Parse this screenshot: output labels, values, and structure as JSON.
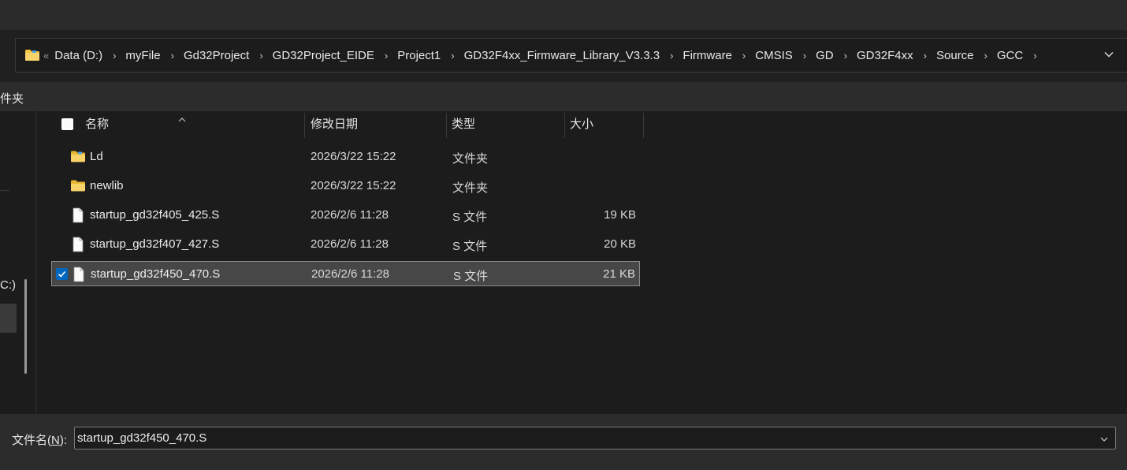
{
  "address": {
    "overflow": "«",
    "crumbs": [
      "Data (D:)",
      "myFile",
      "Gd32Project",
      "GD32Project_EIDE",
      "Project1",
      "GD32F4xx_Firmware_Library_V3.3.3",
      "Firmware",
      "CMSIS",
      "GD",
      "GD32F4xx",
      "Source",
      "GCC"
    ],
    "separator": "›"
  },
  "toolbar": {
    "partial_text": "件夹"
  },
  "nav": {
    "drive_label": "C:)"
  },
  "columns": {
    "name": "名称",
    "date": "修改日期",
    "type": "类型",
    "size": "大小"
  },
  "files": [
    {
      "name": "Ld",
      "date": "2026/3/22 15:22",
      "type": "文件夹",
      "size": "",
      "icon": "folder-icon",
      "selected": false
    },
    {
      "name": "newlib",
      "date": "2026/3/22 15:22",
      "type": "文件夹",
      "size": "",
      "icon": "folder-icon",
      "selected": false
    },
    {
      "name": "startup_gd32f405_425.S",
      "date": "2026/2/6 11:28",
      "type": "S 文件",
      "size": "19 KB",
      "icon": "file-icon",
      "selected": false
    },
    {
      "name": "startup_gd32f407_427.S",
      "date": "2026/2/6 11:28",
      "type": "S 文件",
      "size": "20 KB",
      "icon": "file-icon",
      "selected": false
    },
    {
      "name": "startup_gd32f450_470.S",
      "date": "2026/2/6 11:28",
      "type": "S 文件",
      "size": "21 KB",
      "icon": "file-icon",
      "selected": true
    }
  ],
  "filename": {
    "label_pre": "文件名(",
    "label_key": "N",
    "label_post": "):",
    "value": "startup_gd32f450_470.S"
  },
  "colors": {
    "accent": "#0067c0",
    "folder": "#f4c542",
    "background": "#1c1c1c"
  }
}
